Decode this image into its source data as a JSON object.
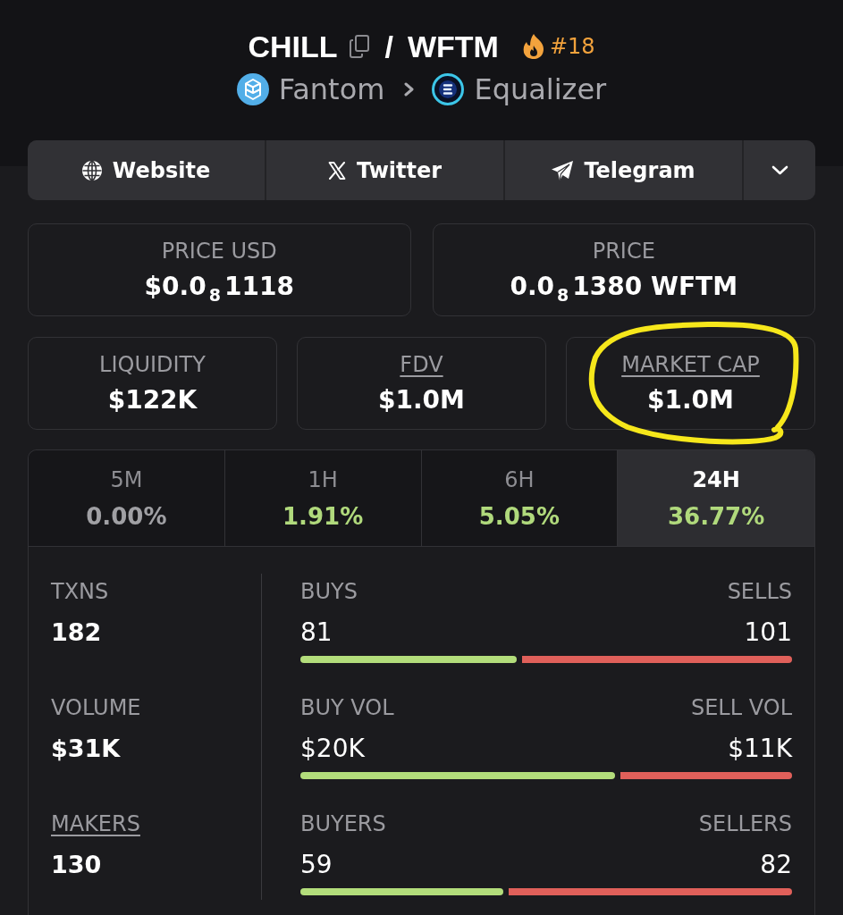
{
  "pair": {
    "base": "CHILL",
    "separator": "/",
    "quote": "WFTM",
    "rank": "#18"
  },
  "breadcrumb": [
    {
      "label": "Fantom",
      "kind": "chain"
    },
    {
      "label": "Equalizer",
      "kind": "dex"
    }
  ],
  "links": [
    {
      "label": "Website",
      "kind": "website"
    },
    {
      "label": "Twitter",
      "kind": "twitter"
    },
    {
      "label": "Telegram",
      "kind": "telegram"
    }
  ],
  "prices": [
    {
      "label": "PRICE USD",
      "value": "$0.0$_{8}$1118"
    },
    {
      "label": "PRICE",
      "value": "0.0$_{8}$1380 WFTM"
    }
  ],
  "metrics": [
    {
      "label": "LIQUIDITY",
      "value": "$122K",
      "underlined": false,
      "circled": false
    },
    {
      "label": "FDV",
      "value": "$1.0M",
      "underlined": true,
      "circled": false
    },
    {
      "label": "MARKET CAP",
      "value": "$1.0M",
      "underlined": true,
      "circled": true
    }
  ],
  "timeframes": [
    {
      "label": "5M",
      "change": "0.00%",
      "color": "#a0a0a4",
      "selected": false
    },
    {
      "label": "1H",
      "change": "1.91%",
      "color": "#b0d97c",
      "selected": false
    },
    {
      "label": "6H",
      "change": "5.05%",
      "color": "#b0d97c",
      "selected": false
    },
    {
      "label": "24H",
      "change": "36.77%",
      "color": "#b0d97c",
      "selected": true
    }
  ],
  "totals": [
    {
      "label": "TXNS",
      "value": "182",
      "underlined": false
    },
    {
      "label": "VOLUME",
      "value": "$31K",
      "underlined": false
    },
    {
      "label": "MAKERS",
      "value": "130",
      "underlined": true
    }
  ],
  "splits": [
    {
      "buy_label": "BUYS",
      "buy_value": "81",
      "sell_label": "SELLS",
      "sell_value": "101",
      "level": 0.445
    },
    {
      "buy_label": "BUY VOL",
      "buy_value": "$20K",
      "sell_label": "SELL VOL",
      "sell_value": "$11K",
      "level": 0.645
    },
    {
      "buy_label": "BUYERS",
      "buy_value": "59",
      "sell_label": "SELLERS",
      "sell_value": "82",
      "level": 0.418
    }
  ]
}
